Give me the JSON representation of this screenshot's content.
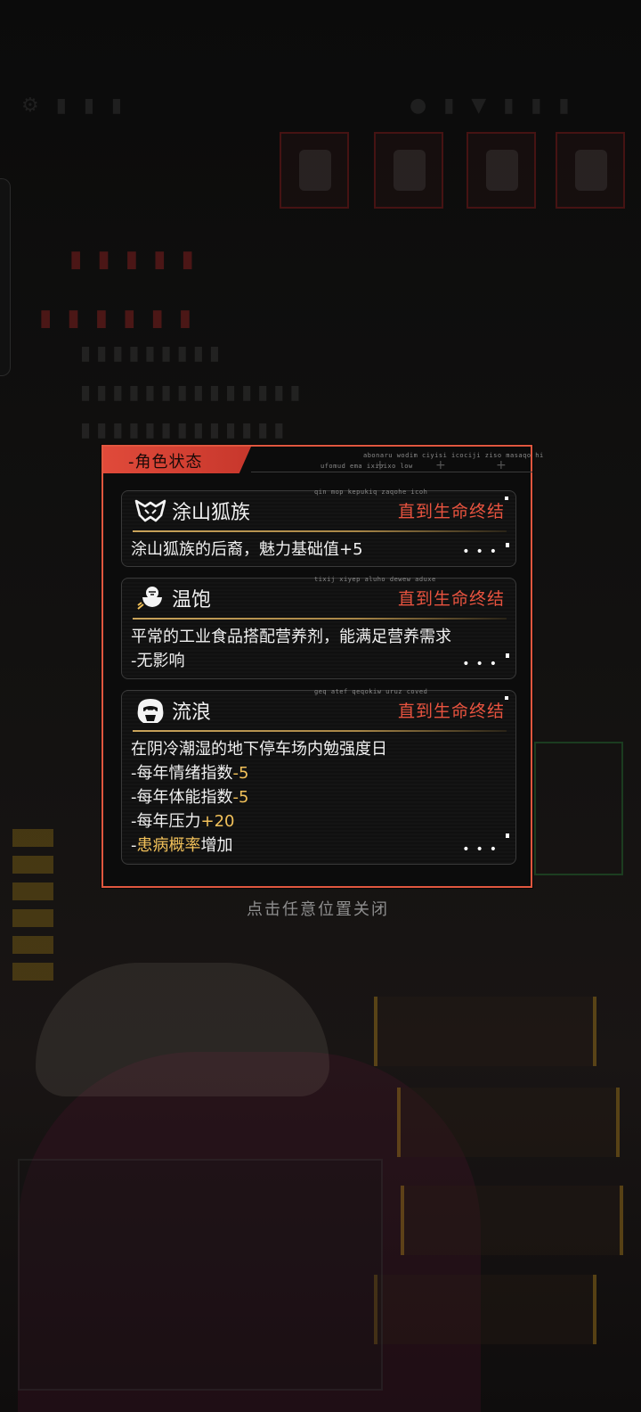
{
  "modal": {
    "title": "-角色状态",
    "deco_line_1": "abonaru wodim ciyisi icociji ziso masaqo hi",
    "deco_line_2": "ufomud ema ixipixo low",
    "border_color": "#e0573f",
    "accent_color": "#e8533f",
    "highlight_color": "#f2c15a"
  },
  "statuses": [
    {
      "name": "涂山狐族",
      "icon": "fox-ears-icon",
      "duration": "直到生命终结",
      "deco": "qin mop kepukiq zaqohe icoh",
      "lines": [
        {
          "parts": [
            {
              "text": "涂山狐族的后裔，魅力基础值+5",
              "highlight": false
            }
          ]
        }
      ]
    },
    {
      "name": "温饱",
      "icon": "rice-bowl-icon",
      "duration": "直到生命终结",
      "deco": "tixij xiyep aluho dewew aduxe",
      "lines": [
        {
          "parts": [
            {
              "text": "平常的工业食品搭配营养剂，能满足营养需求",
              "highlight": false
            }
          ]
        },
        {
          "parts": [
            {
              "text": "-无影响",
              "highlight": false
            }
          ]
        }
      ]
    },
    {
      "name": "流浪",
      "icon": "vagrant-face-icon",
      "duration": "直到生命终结",
      "deco": "geq atef qeqokiw uruz coved",
      "lines": [
        {
          "parts": [
            {
              "text": "在阴冷潮湿的地下停车场内勉强度日",
              "highlight": false
            }
          ]
        },
        {
          "parts": [
            {
              "text": "-每年情绪指数",
              "highlight": false
            },
            {
              "text": "-5",
              "highlight": true
            }
          ]
        },
        {
          "parts": [
            {
              "text": "-每年体能指数",
              "highlight": false
            },
            {
              "text": "-5",
              "highlight": true
            }
          ]
        },
        {
          "parts": [
            {
              "text": "-每年压力",
              "highlight": false
            },
            {
              "text": "+20",
              "highlight": true
            }
          ]
        },
        {
          "parts": [
            {
              "text": "-",
              "highlight": false
            },
            {
              "text": "患病概率",
              "highlight": true
            },
            {
              "text": "增加",
              "highlight": false
            }
          ]
        }
      ]
    }
  ],
  "close_hint": "点击任意位置关闭"
}
